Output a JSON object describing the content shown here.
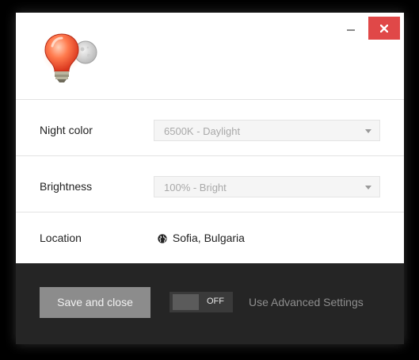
{
  "window": {
    "close_icon": "close-icon",
    "minimize_icon": "minimize-icon",
    "app_icon": "light-bulb-moon-icon"
  },
  "settings": {
    "night_color": {
      "label": "Night color",
      "value": "6500K - Daylight"
    },
    "brightness": {
      "label": "Brightness",
      "value": "100% - Bright"
    },
    "location": {
      "label": "Location",
      "value": "Sofia, Bulgaria",
      "icon": "globe-icon"
    }
  },
  "footer": {
    "save_label": "Save and close",
    "toggle_state": "OFF",
    "advanced_label": "Use Advanced Settings"
  },
  "colors": {
    "close_button": "#e04848",
    "footer_bg": "#252525",
    "save_button": "#8c8c8c"
  }
}
